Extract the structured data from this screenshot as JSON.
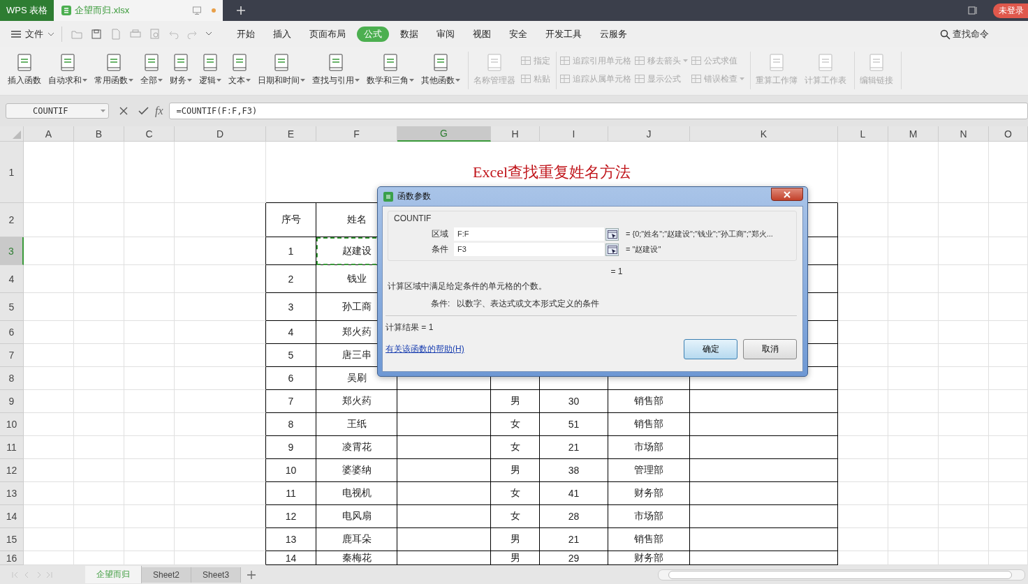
{
  "title_bar": {
    "app_tab": "WPS 表格",
    "doc_tab": {
      "name": "企望而归.xlsx",
      "unsaved": true
    },
    "login_badge": "未登录"
  },
  "menu": {
    "file": "文件",
    "tabs": [
      {
        "label": "开始",
        "selected": false
      },
      {
        "label": "插入",
        "selected": false
      },
      {
        "label": "页面布局",
        "selected": false
      },
      {
        "label": "公式",
        "selected": true
      },
      {
        "label": "数据",
        "selected": false
      },
      {
        "label": "审阅",
        "selected": false
      },
      {
        "label": "视图",
        "selected": false
      },
      {
        "label": "安全",
        "selected": false
      },
      {
        "label": "开发工具",
        "selected": false
      },
      {
        "label": "云服务",
        "selected": false
      }
    ],
    "search": "查找命令"
  },
  "ribbon": {
    "groups": [
      {
        "items": [
          {
            "kind": "large",
            "label": "插入函数",
            "dropdown": false,
            "disabled": false
          },
          {
            "kind": "large",
            "label": "自动求和",
            "dropdown": true,
            "disabled": false
          },
          {
            "kind": "large",
            "label": "常用函数",
            "dropdown": true,
            "disabled": false
          },
          {
            "kind": "large",
            "label": "全部",
            "dropdown": true,
            "disabled": false
          },
          {
            "kind": "large",
            "label": "财务",
            "dropdown": true,
            "disabled": false
          },
          {
            "kind": "large",
            "label": "逻辑",
            "dropdown": true,
            "disabled": false
          },
          {
            "kind": "large",
            "label": "文本",
            "dropdown": true,
            "disabled": false
          },
          {
            "kind": "large",
            "label": "日期和时间",
            "dropdown": true,
            "disabled": false
          },
          {
            "kind": "large",
            "label": "查找与引用",
            "dropdown": true,
            "disabled": false
          },
          {
            "kind": "large",
            "label": "数学和三角",
            "dropdown": true,
            "disabled": false
          },
          {
            "kind": "large",
            "label": "其他函数",
            "dropdown": true,
            "disabled": false
          }
        ]
      },
      {
        "items": [
          {
            "kind": "large",
            "label": "名称管理器",
            "dropdown": false,
            "disabled": true
          },
          {
            "kind": "small",
            "label": "指定",
            "dropdown": false,
            "disabled": true
          },
          {
            "kind": "small",
            "label": "粘贴",
            "dropdown": false,
            "disabled": true
          }
        ]
      },
      {
        "items": [
          {
            "kind": "small",
            "label": "追踪引用单元格",
            "dropdown": false,
            "disabled": true
          },
          {
            "kind": "small",
            "label": "追踪从属单元格",
            "dropdown": false,
            "disabled": true
          },
          {
            "kind": "small",
            "label": "移去箭头",
            "dropdown": true,
            "disabled": true
          },
          {
            "kind": "small",
            "label": "显示公式",
            "dropdown": false,
            "disabled": true
          },
          {
            "kind": "small",
            "label": "公式求值",
            "dropdown": false,
            "disabled": true
          },
          {
            "kind": "small",
            "label": "错误检查",
            "dropdown": true,
            "disabled": true
          }
        ]
      },
      {
        "items": [
          {
            "kind": "large",
            "label": "重算工作簿",
            "dropdown": false,
            "disabled": true
          },
          {
            "kind": "large",
            "label": "计算工作表",
            "dropdown": false,
            "disabled": true
          }
        ]
      },
      {
        "items": [
          {
            "kind": "large",
            "label": "编辑链接",
            "dropdown": false,
            "disabled": true
          }
        ]
      }
    ]
  },
  "formula_bar": {
    "name_box": "COUNTIF",
    "fx_label": "fx",
    "formula": "=COUNTIF(F:F,F3)"
  },
  "sheet": {
    "columns": [
      {
        "label": "A",
        "selected": false
      },
      {
        "label": "B",
        "selected": false
      },
      {
        "label": "C",
        "selected": false
      },
      {
        "label": "D",
        "selected": false
      },
      {
        "label": "E",
        "selected": false
      },
      {
        "label": "F",
        "selected": false
      },
      {
        "label": "G",
        "selected": true
      },
      {
        "label": "H",
        "selected": false
      },
      {
        "label": "I",
        "selected": false
      },
      {
        "label": "J",
        "selected": false
      },
      {
        "label": "K",
        "selected": false
      },
      {
        "label": "L",
        "selected": false
      },
      {
        "label": "M",
        "selected": false
      },
      {
        "label": "N",
        "selected": false
      },
      {
        "label": "O",
        "selected": false
      }
    ],
    "rows": [
      {
        "label": "1",
        "selected": false
      },
      {
        "label": "2",
        "selected": false
      },
      {
        "label": "3",
        "selected": true
      },
      {
        "label": "4",
        "selected": false
      },
      {
        "label": "5",
        "selected": false
      },
      {
        "label": "6",
        "selected": false
      },
      {
        "label": "7",
        "selected": false
      },
      {
        "label": "8",
        "selected": false
      },
      {
        "label": "9",
        "selected": false
      },
      {
        "label": "10",
        "selected": false
      },
      {
        "label": "11",
        "selected": false
      },
      {
        "label": "12",
        "selected": false
      },
      {
        "label": "13",
        "selected": false
      },
      {
        "label": "14",
        "selected": false
      },
      {
        "label": "15",
        "selected": false
      },
      {
        "label": "16",
        "selected": false
      }
    ],
    "title": "Excel查找重复姓名方法",
    "table": {
      "header": [
        "序号",
        "姓名"
      ],
      "records": [
        {
          "seq": "1",
          "name": "赵建设",
          "copy_marked": true
        },
        {
          "seq": "2",
          "name": "钱业",
          "copy_marked": false
        },
        {
          "seq": "3",
          "name": "孙工商",
          "copy_marked": false
        },
        {
          "seq": "4",
          "name": "郑火药",
          "copy_marked": false
        },
        {
          "seq": "5",
          "name": "唐三串",
          "copy_marked": false
        },
        {
          "seq": "6",
          "name": "吴刷",
          "copy_marked": false
        },
        {
          "seq": "7",
          "name": "郑火药",
          "gender": "男",
          "age": "30",
          "dept": "销售部",
          "copy_marked": false
        },
        {
          "seq": "8",
          "name": "王纸",
          "gender": "女",
          "age": "51",
          "dept": "销售部",
          "copy_marked": false
        },
        {
          "seq": "9",
          "name": "凌霄花",
          "gender": "女",
          "age": "21",
          "dept": "市场部",
          "copy_marked": false
        },
        {
          "seq": "10",
          "name": "婆婆纳",
          "gender": "男",
          "age": "38",
          "dept": "管理部",
          "copy_marked": false
        },
        {
          "seq": "11",
          "name": "电视机",
          "gender": "女",
          "age": "41",
          "dept": "财务部",
          "copy_marked": false
        },
        {
          "seq": "12",
          "name": "电风扇",
          "gender": "女",
          "age": "28",
          "dept": "市场部",
          "copy_marked": false
        },
        {
          "seq": "13",
          "name": "鹿耳朵",
          "gender": "男",
          "age": "21",
          "dept": "销售部",
          "copy_marked": false
        },
        {
          "seq": "14",
          "name": "秦梅花",
          "gender": "男",
          "age": "29",
          "dept": "财务部",
          "copy_marked": false
        }
      ]
    }
  },
  "sheet_tabs": [
    {
      "label": "企望而归",
      "selected": true
    },
    {
      "label": "Sheet2",
      "selected": false
    },
    {
      "label": "Sheet3",
      "selected": false
    }
  ],
  "dialog": {
    "title": "函数参数",
    "function": "COUNTIF",
    "arguments": [
      {
        "label": "区域",
        "value": "F:F",
        "result": "= {0;\"姓名\";\"赵建设\";\"钱业\";\"孙工商\";\"郑火..."
      },
      {
        "label": "条件",
        "value": "F3",
        "result": "= \"赵建设\""
      }
    ],
    "formula_result": "= 1",
    "description": "计算区域中满足给定条件的单元格的个数。",
    "arg_help_label": "条件:",
    "arg_help": "以数字、表达式或文本形式定义的条件",
    "result_line": "计算结果 = 1",
    "help_link": "有关该函数的帮助(H)",
    "buttons": [
      {
        "label": "确定",
        "default": true
      },
      {
        "label": "取消",
        "default": false
      }
    ]
  }
}
